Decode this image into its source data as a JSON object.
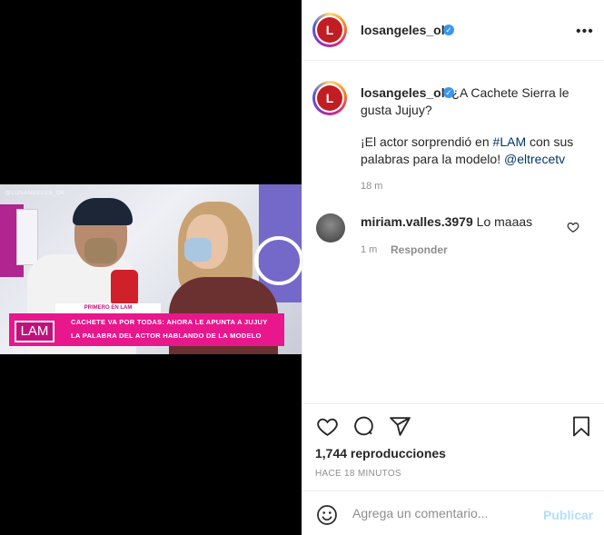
{
  "post": {
    "author": "losangeles_ok",
    "verified_icon": "verified-badge-icon",
    "more_icon": "more-options-icon"
  },
  "video": {
    "watermark": "@LOSANGELES_OK",
    "tag": "PRIMERO EN LAM",
    "logo": "LAM",
    "headline_line1": "CACHETE VA POR TODAS: AHORA LE APUNTA A JUJUY",
    "headline_line2": "LA PALABRA DEL ACTOR HABLANDO DE LA MODELO"
  },
  "caption": {
    "username": "losangeles_ok",
    "text1": "¿A Cachete Sierra le gusta Jujuy?",
    "text2_prefix": "¡El actor sorprendió en ",
    "hashtag": "#LAM",
    "text2_middle": " con sus palabras para la modelo! ",
    "mention": "@eltrecetv",
    "time": "18 m"
  },
  "comments": [
    {
      "username": "miriam.valles.3979",
      "text": "Lo maaas",
      "time": "1 m",
      "reply_label": "Responder"
    }
  ],
  "actions": {
    "like_icon": "heart-icon",
    "comment_icon": "comment-icon",
    "share_icon": "share-icon",
    "save_icon": "bookmark-icon"
  },
  "stats": {
    "views": "1,744 reproducciones",
    "posted_ago": "HACE 18 MINUTOS"
  },
  "composer": {
    "emoji_icon": "emoji-icon",
    "placeholder": "Agrega un comentario...",
    "publish_label": "Publicar"
  },
  "colors": {
    "accent_blue": "#3897f0",
    "link": "#00376b",
    "lower_third": "#e8178c",
    "publish_disabled": "#b2dffc"
  }
}
